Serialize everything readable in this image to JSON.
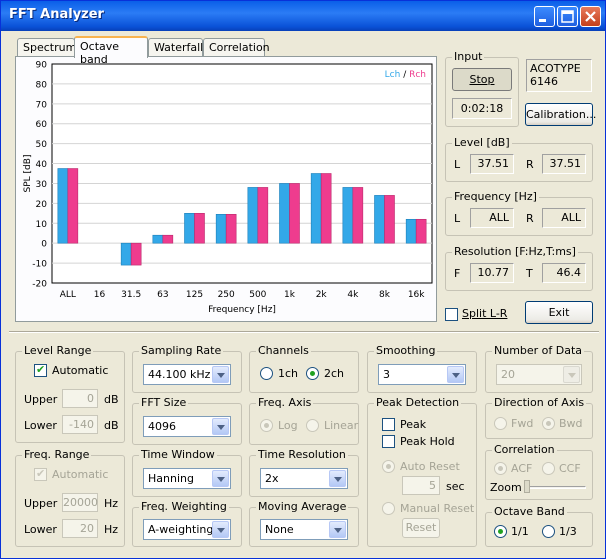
{
  "window": {
    "title": "FFT Analyzer"
  },
  "tabs": [
    {
      "label": "Spectrum"
    },
    {
      "label": "Octave band",
      "active": true
    },
    {
      "label": "Waterfall"
    },
    {
      "label": "Correlation"
    }
  ],
  "chart_data": {
    "type": "bar",
    "legend": {
      "left": "Lch",
      "sep": " / ",
      "right": "Rch",
      "placement": "top-right"
    },
    "xlabel": "Frequency [Hz]",
    "ylabel": "SPL [dB]",
    "ylim": [
      -20,
      90
    ],
    "yticks": [
      90,
      80,
      70,
      60,
      50,
      40,
      30,
      20,
      10,
      0,
      -10,
      -20
    ],
    "categories": [
      "ALL",
      "16",
      "31.5",
      "63",
      "125",
      "250",
      "500",
      "1k",
      "2k",
      "4k",
      "8k",
      "16k"
    ],
    "series": [
      {
        "name": "Lch",
        "color": "#33a8e8",
        "values": [
          37.5,
          null,
          -11,
          4,
          15,
          14.5,
          28,
          30,
          35,
          28,
          24,
          12
        ]
      },
      {
        "name": "Rch",
        "color": "#ee3c8e",
        "values": [
          37.5,
          null,
          -11,
          4,
          15,
          14.5,
          28,
          30,
          35,
          28,
          24,
          12
        ]
      }
    ],
    "grid": true
  },
  "input": {
    "title": "Input",
    "stop_label": "Stop",
    "elapsed": "0:02:18",
    "device": "ACOTYPE\n6146",
    "calibration_label": "Calibration..."
  },
  "level": {
    "title": "Level [dB]",
    "l_label": "L",
    "l_value": "37.51",
    "r_label": "R",
    "r_value": "37.51"
  },
  "frequency": {
    "title": "Frequency [Hz]",
    "l_label": "L",
    "l_value": "ALL",
    "r_label": "R",
    "r_value": "ALL"
  },
  "resolution": {
    "title": "Resolution [F:Hz,T:ms]",
    "f_label": "F",
    "f_value": "10.77",
    "t_label": "T",
    "t_value": "46.4"
  },
  "split_lr": {
    "label": "Split L-R",
    "checked": false
  },
  "exit_label": "Exit",
  "level_range": {
    "title": "Level Range",
    "auto_label": "Automatic",
    "upper_label": "Upper",
    "upper_value": "0",
    "upper_unit": "dB",
    "lower_label": "Lower",
    "lower_value": "-140",
    "lower_unit": "dB"
  },
  "freq_range": {
    "title": "Freq. Range",
    "auto_label": "Automatic",
    "upper_label": "Upper",
    "upper_value": "20000",
    "upper_unit": "Hz",
    "lower_label": "Lower",
    "lower_value": "20",
    "lower_unit": "Hz"
  },
  "sampling_rate": {
    "title": "Sampling Rate",
    "value": "44.100 kHz"
  },
  "fft_size": {
    "title": "FFT Size",
    "value": "4096"
  },
  "time_window": {
    "title": "Time Window",
    "value": "Hanning"
  },
  "freq_weighting": {
    "title": "Freq. Weighting",
    "value": "A-weighting"
  },
  "channels": {
    "title": "Channels",
    "opt1": "1ch",
    "opt2": "2ch"
  },
  "freq_axis": {
    "title": "Freq. Axis",
    "opt1": "Log",
    "opt2": "Linear"
  },
  "time_resolution": {
    "title": "Time Resolution",
    "value": "2x"
  },
  "moving_average": {
    "title": "Moving Average",
    "value": "None"
  },
  "smoothing": {
    "title": "Smoothing",
    "value": "3"
  },
  "peak_detection": {
    "title": "Peak Detection",
    "peak_label": "Peak",
    "peak_hold_label": "Peak Hold",
    "auto_reset_label": "Auto Reset",
    "seconds_value": "5",
    "seconds_unit": "sec",
    "manual_reset_label": "Manual Reset",
    "reset_label": "Reset"
  },
  "number_of_data": {
    "title": "Number of Data",
    "value": "20"
  },
  "direction_of_axis": {
    "title": "Direction of Axis",
    "opt1": "Fwd",
    "opt2": "Bwd"
  },
  "correlation": {
    "title": "Correlation",
    "opt1": "ACF",
    "opt2": "CCF",
    "zoom_label": "Zoom"
  },
  "octave_band": {
    "title": "Octave Band",
    "opt1": "1/1",
    "opt2": "1/3"
  }
}
